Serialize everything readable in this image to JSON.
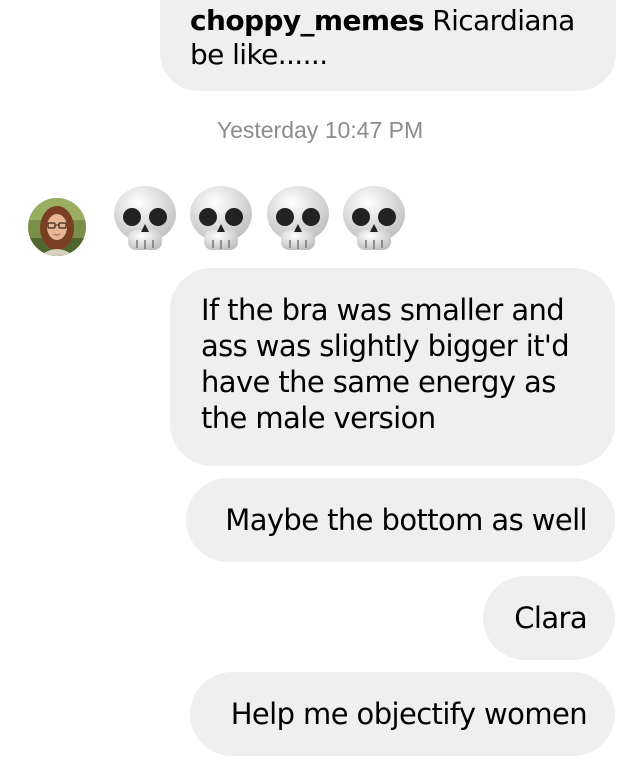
{
  "messages": {
    "top_user": "choppy_memes",
    "top_text": "Ricardiana be like......",
    "timestamp": "Yesterday 10:47 PM",
    "reaction_icons": [
      "skull-emoji",
      "skull-emoji",
      "skull-emoji",
      "skull-emoji"
    ],
    "long_text": "If the bra was smaller and ass was slightly bigger it'd have the same energy as the male version",
    "text_2": "Maybe the bottom as well",
    "text_3": "Clara",
    "text_4": "Help me objectify women"
  },
  "colors": {
    "bubble": "#efefef",
    "timestamp": "#8c8c8c",
    "text": "#000000"
  }
}
